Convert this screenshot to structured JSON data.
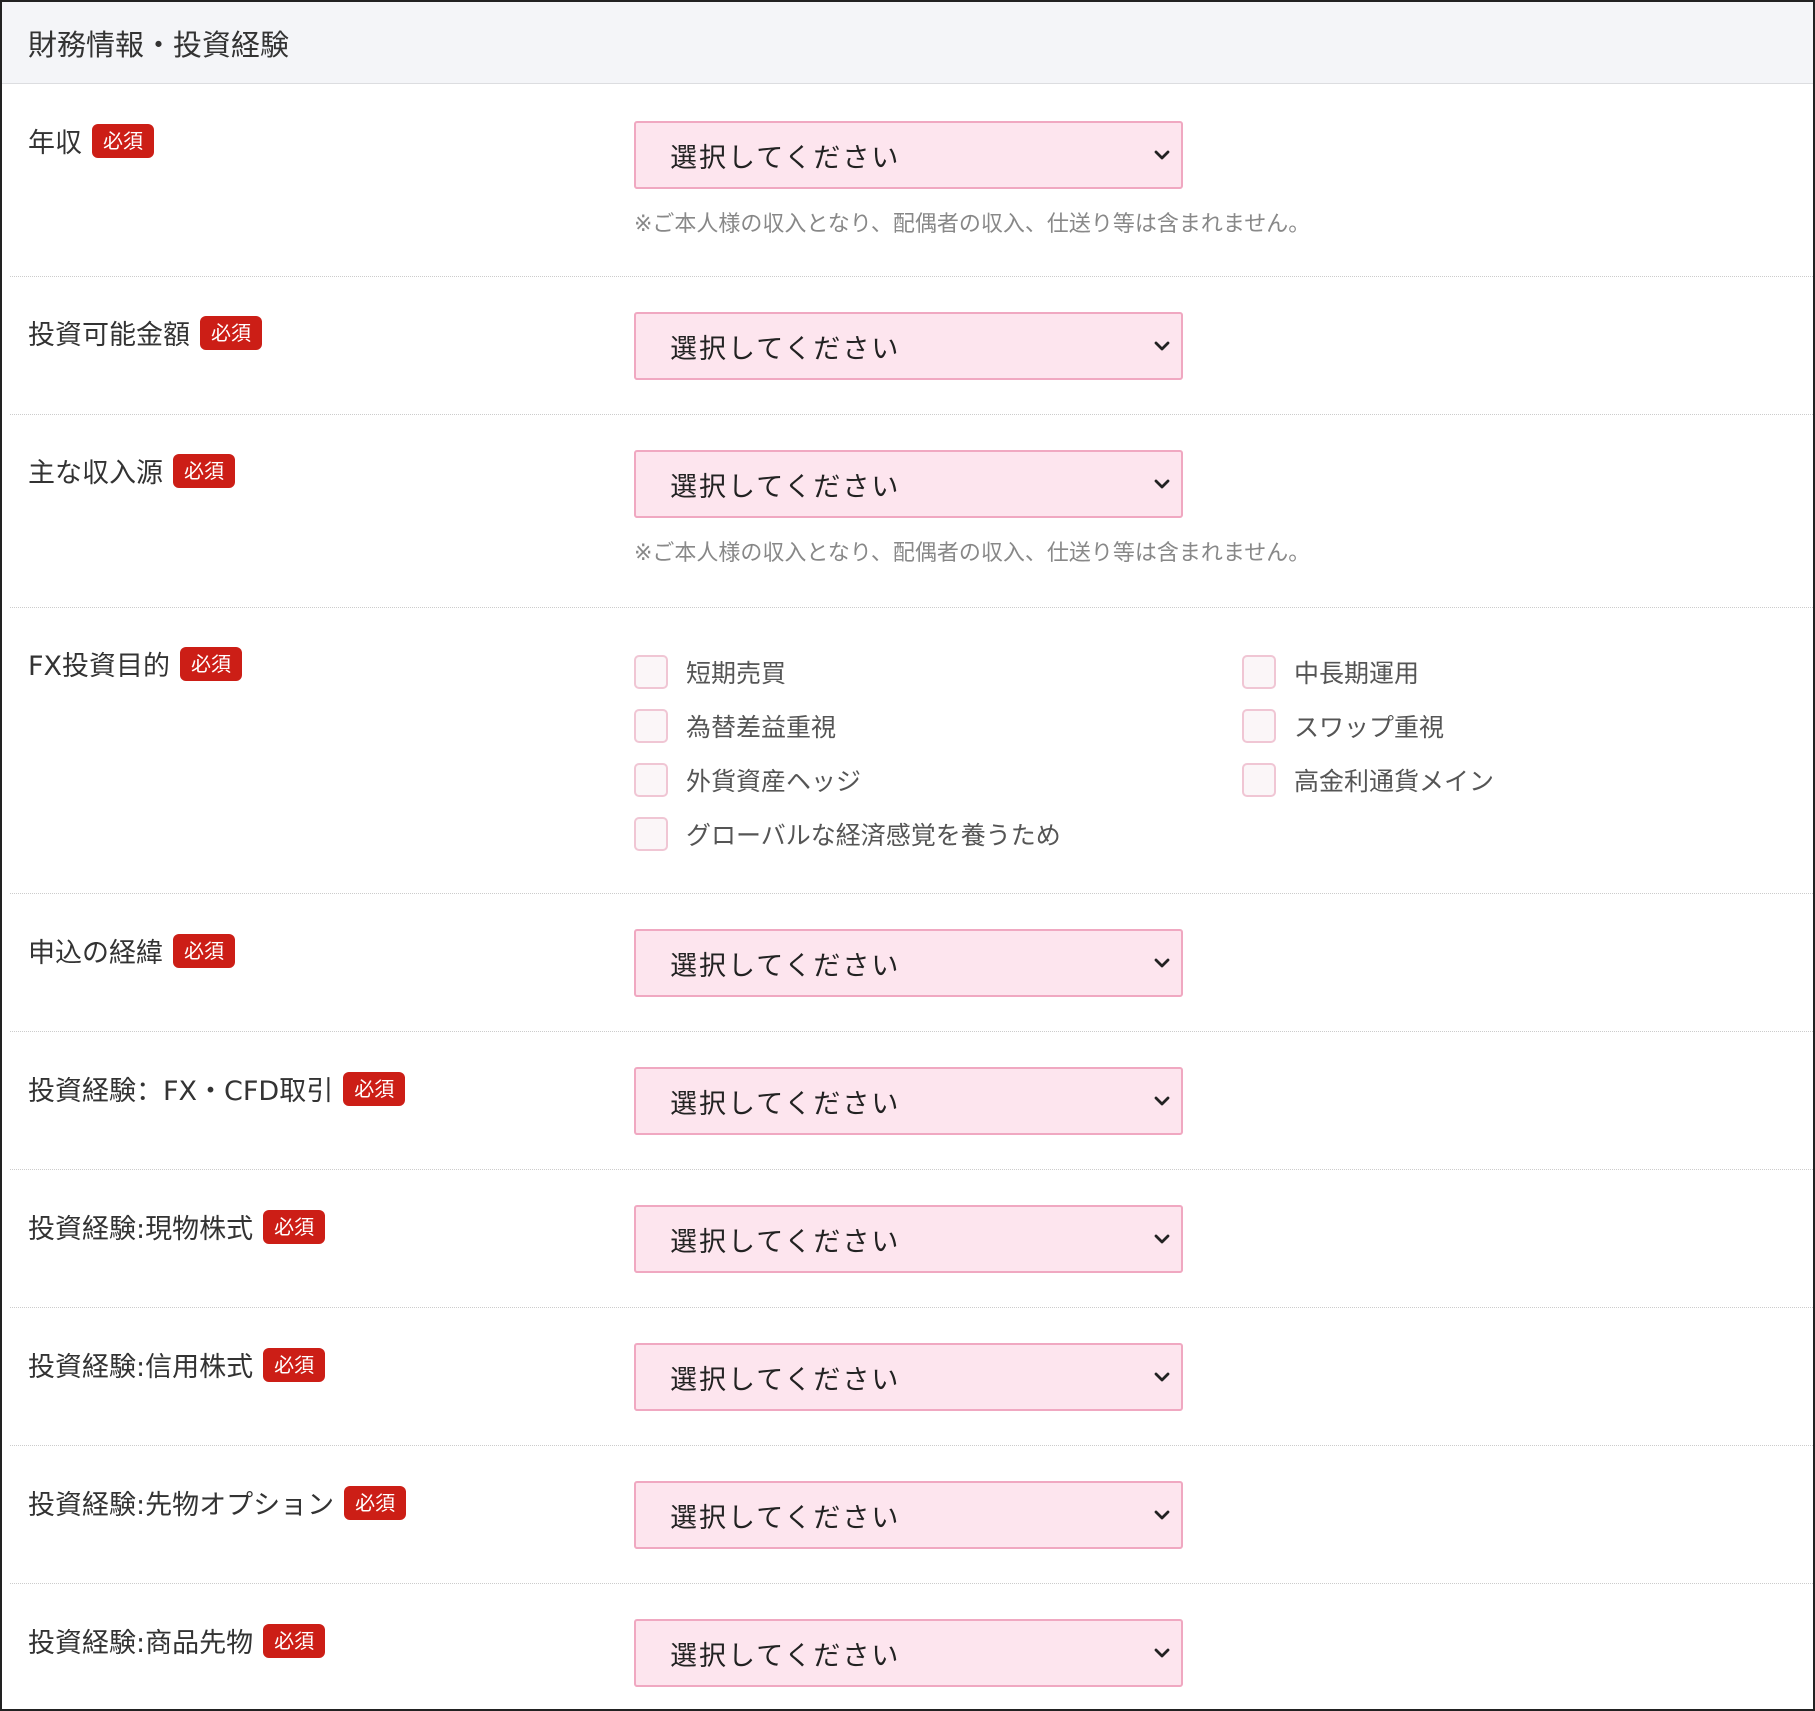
{
  "section": {
    "title": "財務情報・投資経験"
  },
  "required_badge": "必須",
  "select_placeholder": "選択してください",
  "note_text": "※ご本人様の収入となり、配偶者の収入、仕送り等は含まれません。",
  "fields": {
    "annual_income": {
      "label": "年収"
    },
    "investable_amount": {
      "label": "投資可能金額"
    },
    "main_income_source": {
      "label": "主な収入源"
    },
    "fx_purpose": {
      "label": "FX投資目的",
      "options": [
        "短期売買",
        "中長期運用",
        "為替差益重視",
        "スワップ重視",
        "外貨資産ヘッジ",
        "高金利通貨メイン",
        "グローバルな経済感覚を養うため"
      ]
    },
    "application_reason": {
      "label": "申込の経緯"
    },
    "exp_fx_cfd": {
      "label": "投資経験：FX・CFD取引"
    },
    "exp_spot_stocks": {
      "label": "投資経験:現物株式"
    },
    "exp_margin_stocks": {
      "label": "投資経験:信用株式"
    },
    "exp_futures_options": {
      "label": "投資経験:先物オプション"
    },
    "exp_commodity_futures": {
      "label": "投資経験:商品先物"
    }
  },
  "icons": {
    "select_arrow": "chevron-down-icon"
  },
  "colors": {
    "badge": "#cc1e16",
    "select_bg": "#fde5ee",
    "select_border": "#f0a8c1",
    "header_bg": "#f4f5f8"
  }
}
